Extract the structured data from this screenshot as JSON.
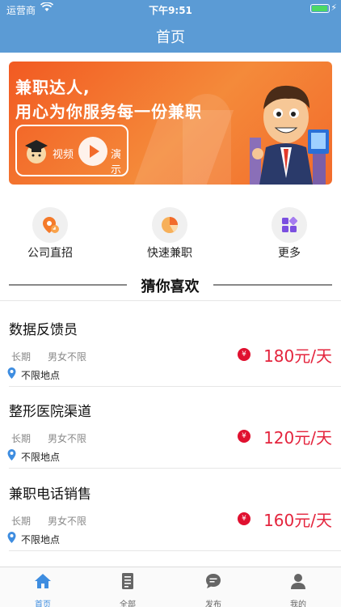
{
  "status_bar": {
    "carrier": "运营商",
    "time": "下午9:51"
  },
  "nav": {
    "title": "首页"
  },
  "banner": {
    "line1": "兼职达人,",
    "line2": "用心为你服务每一份兼职",
    "video_label": "视频",
    "demo_label": "演示"
  },
  "quick_entries": [
    {
      "label": "公司直招",
      "icon": "location-pin-icon"
    },
    {
      "label": "快速兼职",
      "icon": "pie-chart-icon"
    },
    {
      "label": "更多",
      "icon": "apps-grid-icon"
    }
  ],
  "section": {
    "title": "猜你喜欢"
  },
  "jobs": [
    {
      "title": "数据反馈员",
      "term": "长期",
      "gender": "男女不限",
      "currency": "¥",
      "salary": "180元/天",
      "location": "不限地点"
    },
    {
      "title": "整形医院渠道",
      "term": "长期",
      "gender": "男女不限",
      "currency": "¥",
      "salary": "120元/天",
      "location": "不限地点"
    },
    {
      "title": "兼职电话销售",
      "term": "长期",
      "gender": "男女不限",
      "currency": "¥",
      "salary": "160元/天",
      "location": "不限地点"
    }
  ],
  "tabbar": [
    {
      "label": "首页",
      "icon": "home-icon",
      "active": true
    },
    {
      "label": "全部",
      "icon": "document-list-icon",
      "active": false
    },
    {
      "label": "发布",
      "icon": "chat-bubble-icon",
      "active": false
    },
    {
      "label": "我的",
      "icon": "user-icon",
      "active": false
    }
  ],
  "colors": {
    "nav": "#5b9bd5",
    "accent": "#e4243d",
    "banner": "#f26b2b",
    "tab_active": "#3e8de0"
  }
}
